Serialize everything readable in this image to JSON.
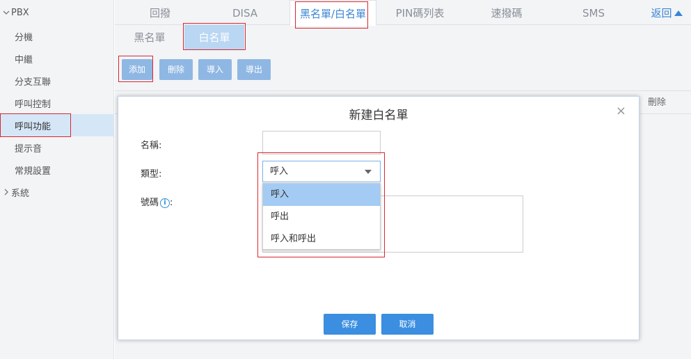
{
  "sidebar": {
    "pbx_label": "PBX",
    "items": [
      {
        "label": "分機"
      },
      {
        "label": "中繼"
      },
      {
        "label": "分支互聯"
      },
      {
        "label": "呼叫控制"
      },
      {
        "label": "呼叫功能"
      },
      {
        "label": "提示音"
      },
      {
        "label": "常規設置"
      }
    ],
    "system_label": "系統"
  },
  "tabs": [
    {
      "label": "回撥"
    },
    {
      "label": "DISA"
    },
    {
      "label": "黑名單/白名單"
    },
    {
      "label": "PIN碼列表"
    },
    {
      "label": "速撥碼"
    },
    {
      "label": "SMS"
    }
  ],
  "back_label": "返回",
  "subtabs": [
    {
      "label": "黑名單"
    },
    {
      "label": "白名單"
    }
  ],
  "toolbar": {
    "add": "添加",
    "delete": "刪除",
    "import": "導入",
    "export": "導出"
  },
  "table": {
    "delete_header": "刪除"
  },
  "modal": {
    "title": "新建白名單",
    "close": "×",
    "name_label": "名稱:",
    "name_value": "",
    "type_label": "類型:",
    "type_value": "呼入",
    "number_label": "號碼",
    "number_colon": ":",
    "number_value": "",
    "type_options": [
      "呼入",
      "呼出",
      "呼入和呼出"
    ],
    "save": "保存",
    "cancel": "取消"
  },
  "colors": {
    "accent": "#3b8ee0",
    "highlight_box": "#d9262f",
    "active_tab_text": "#3a84d6"
  }
}
